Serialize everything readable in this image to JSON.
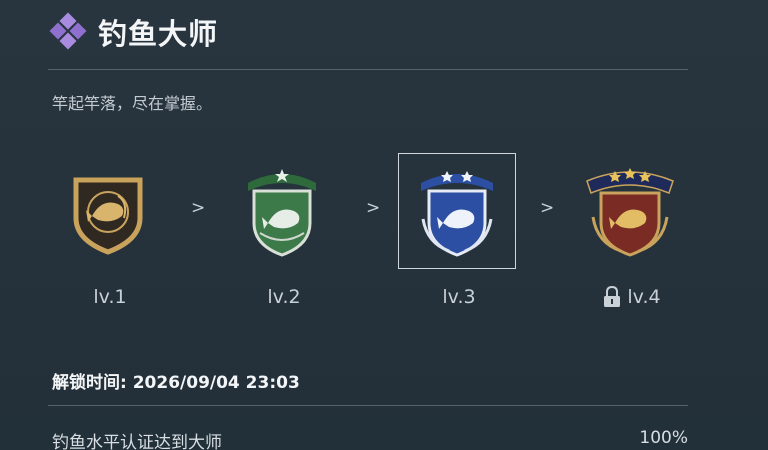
{
  "header": {
    "title": "钓鱼大师",
    "icon": "diamond-cluster-icon",
    "subtitle": "竿起竿落，尽在掌握。"
  },
  "levels": [
    {
      "label": "lv.1",
      "badge": "bronze-fish-badge-icon",
      "locked": false,
      "selected": false
    },
    {
      "label": "lv.2",
      "badge": "green-fish-badge-icon",
      "locked": false,
      "selected": false
    },
    {
      "label": "lv.3",
      "badge": "blue-fish-badge-icon",
      "locked": false,
      "selected": true
    },
    {
      "label": "lv.4",
      "badge": "red-gold-fish-badge-icon",
      "locked": true,
      "selected": false
    }
  ],
  "arrow_symbol": ">",
  "unlock": {
    "text": "解锁时间: 2026/09/04 23:03"
  },
  "task": {
    "label": "钓鱼水平认证达到大师",
    "value": "100%"
  },
  "colors": {
    "background": "#26323d",
    "accent_purple": "#a98be0",
    "bronze": "#c9a35c",
    "green": "#3d7a4a",
    "blue": "#2c4fa3",
    "red": "#7a2b23"
  }
}
